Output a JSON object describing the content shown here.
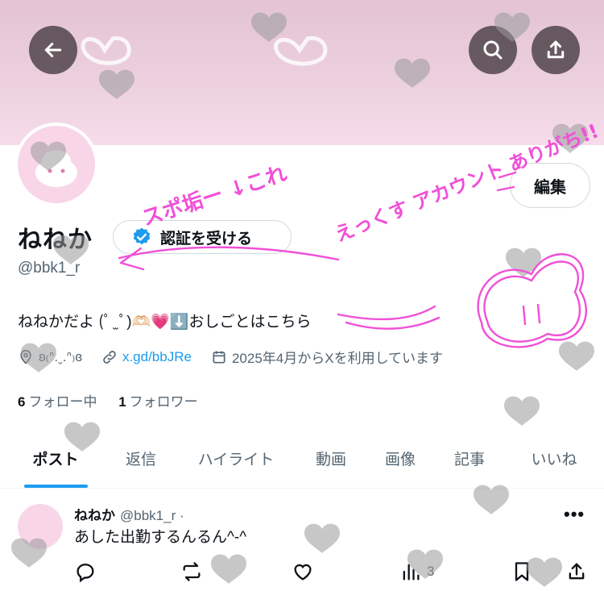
{
  "profile": {
    "display_name": "ねねか",
    "handle": "@bbk1_r",
    "verify_label": "認証を受ける",
    "edit_label": "編集",
    "bio": "ねねかだよ (ﾟ ̫ ﾟ)🫶🏻💗⬇️おしごとはこちら",
    "location": "ʚ₍ᐢ.ˬ.ᐢ₎ɞ",
    "link": "x.gd/bbJRe",
    "joined": "2025年4月からXを利用しています",
    "following_count": "6",
    "following_label": "フォロー中",
    "followers_count": "1",
    "followers_label": "フォロワー"
  },
  "tabs": [
    {
      "label": "ポスト",
      "active": true
    },
    {
      "label": "返信"
    },
    {
      "label": "ハイライト"
    },
    {
      "label": "動画"
    },
    {
      "label": "画像"
    },
    {
      "label": "記事"
    },
    {
      "label": "いいね"
    }
  ],
  "post": {
    "name": "ねねか",
    "handle": "@bbk1_r ·",
    "more": "•••",
    "text": "あした出勤するんるん^-^",
    "views": "3"
  },
  "overlay_text": {
    "note1": "スポ垢ー ↓これ",
    "note2": "えっくす アカウント ありがち!!"
  },
  "icons": {
    "back": "arrow-left-icon",
    "search": "search-icon",
    "share": "share-icon",
    "verified": "verified-badge-icon",
    "location": "location-icon",
    "link": "link-icon",
    "calendar": "calendar-icon",
    "reply": "reply-icon",
    "repost": "repost-icon",
    "like": "like-icon",
    "views": "views-icon",
    "bookmark": "bookmark-icon"
  },
  "colors": {
    "accent": "#1d9bf0",
    "banner": "#e8c8d8",
    "overlay_pink": "#f050d8",
    "heart_gray": "#9a9a9a"
  }
}
